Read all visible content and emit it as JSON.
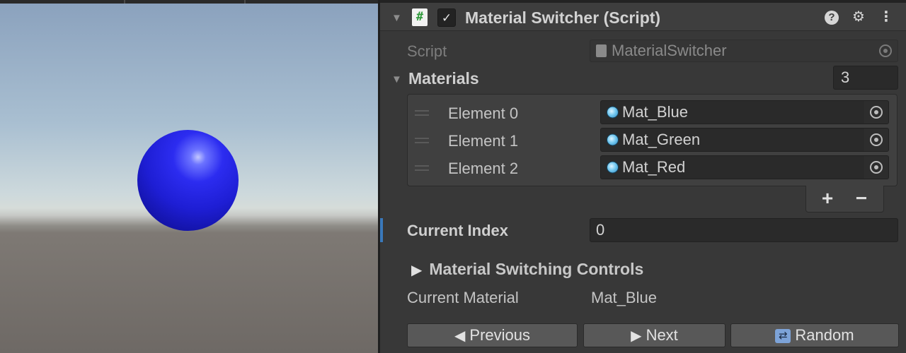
{
  "component": {
    "title": "Material Switcher (Script)",
    "script_icon": "#",
    "enabled_check": "✓",
    "help_icon": "?",
    "preset_icon": "⚙",
    "menu_icon": "⋮"
  },
  "script_field": {
    "label": "Script",
    "value": "MaterialSwitcher"
  },
  "materials": {
    "label": "Materials",
    "size": "3",
    "items": [
      {
        "label": "Element 0",
        "value": "Mat_Blue"
      },
      {
        "label": "Element 1",
        "value": "Mat_Green"
      },
      {
        "label": "Element 2",
        "value": "Mat_Red"
      }
    ],
    "add_label": "+",
    "remove_label": "−"
  },
  "current_index": {
    "label": "Current Index",
    "value": "0"
  },
  "controls_section": {
    "title": "Material Switching Controls"
  },
  "current_material": {
    "label": "Current Material",
    "value": "Mat_Blue"
  },
  "buttons": {
    "previous": "Previous",
    "next": "Next",
    "random": "Random"
  },
  "colors": {
    "sphere": "#2323e0",
    "inspector_bg": "#383838",
    "focus_accent": "#3a79bb"
  }
}
